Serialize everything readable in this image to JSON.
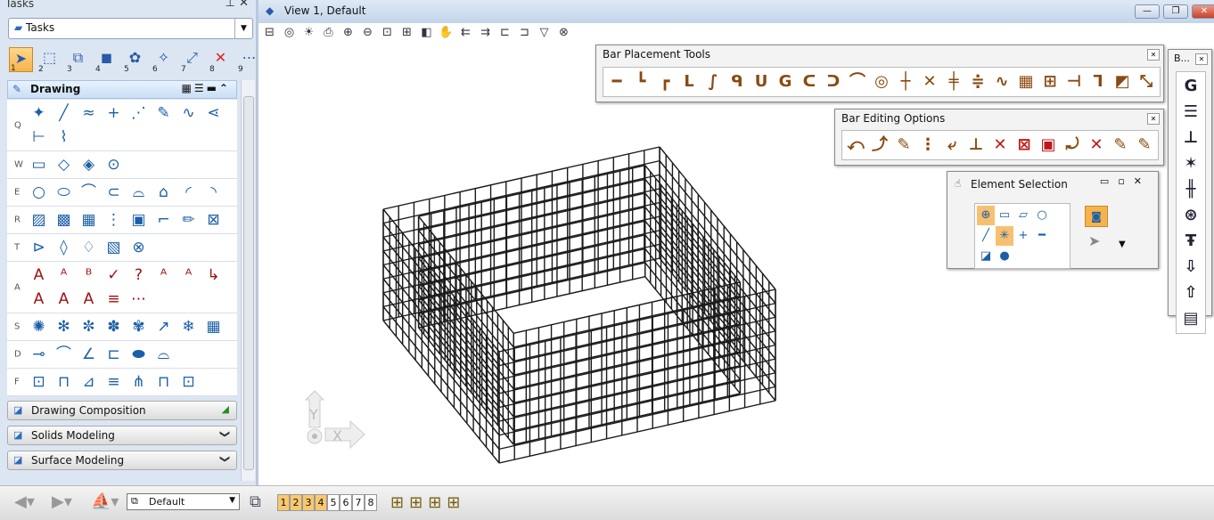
{
  "tasks_panel": {
    "title": "Tasks",
    "dropdown_value": "Tasks",
    "task_tools": [
      {
        "n": "1",
        "icon": "select-arrow-icon"
      },
      {
        "n": "2",
        "icon": "selection-box-icon"
      },
      {
        "n": "3",
        "icon": "3d-box-icon"
      },
      {
        "n": "4",
        "icon": "cube-icon"
      },
      {
        "n": "5",
        "icon": "render-icon"
      },
      {
        "n": "6",
        "icon": "light-icon"
      },
      {
        "n": "7",
        "icon": "scale-icon"
      },
      {
        "n": "8",
        "icon": "delete-icon"
      },
      {
        "n": "9",
        "icon": "measure-icon"
      }
    ],
    "drawing": {
      "label": "Drawing",
      "rows": [
        {
          "letter": "Q",
          "icons": [
            "place-smartline-icon",
            "line-icon",
            "multiline-icon",
            "point-icon",
            "polyline-icon",
            "pencil-line-icon",
            "curve-icon",
            "branch-icon",
            "dimension-icon",
            "construct-icon"
          ]
        },
        {
          "letter": "W",
          "icons": [
            "rectangle-icon",
            "shape-icon",
            "rotated-shape-icon",
            "circle-point-icon"
          ]
        },
        {
          "letter": "E",
          "icons": [
            "circle-icon",
            "ellipse-icon",
            "arc-icon",
            "arc-2-icon",
            "arc-3-icon",
            "arc-4-icon",
            "arc-5-icon",
            "arc-6-icon"
          ]
        },
        {
          "letter": "R",
          "icons": [
            "hatch-icon",
            "crosshatch-icon",
            "pattern-icon",
            "fill-icon",
            "region-icon",
            "area-icon",
            "edit-icon",
            "delete-pattern-icon"
          ]
        },
        {
          "letter": "T",
          "icons": [
            "cell-icon",
            "cell-2-icon",
            "cell-3-icon",
            "cell-4-icon",
            "cell-delete-icon"
          ]
        },
        {
          "letter": "A",
          "icons": [
            "text-icon",
            "text-leader-icon",
            "text-above-icon",
            "spell-check-icon",
            "text-query-icon",
            "text-scale-icon",
            "text-up-icon",
            "text-node-icon",
            "text-replace-icon",
            "text-align-icon",
            "text-align-2-icon",
            "text-box-icon",
            "text-note-icon"
          ]
        },
        {
          "letter": "S",
          "icons": [
            "snowflake-icon",
            "snowflake-2-icon",
            "snowflake-3-icon",
            "snowflake-4-icon",
            "snowflake-5-icon",
            "arrow-icon",
            "snowflake-6-icon",
            "table-icon"
          ]
        },
        {
          "letter": "D",
          "icons": [
            "dimension-linear-icon",
            "dimension-radial-icon",
            "dimension-angle-icon",
            "dimension-size-icon",
            "dimension-ordinate-icon",
            "dimension-element-icon"
          ]
        },
        {
          "letter": "F",
          "icons": [
            "frame-icon",
            "frame-2-icon",
            "frame-3-icon",
            "frame-4-icon",
            "frame-5-icon",
            "frame-6-icon",
            "frame-7-icon"
          ]
        }
      ]
    },
    "sections": [
      {
        "label": "Drawing Composition",
        "icon": "drawing-composition-icon"
      },
      {
        "label": "Solids Modeling",
        "icon": "solids-icon"
      },
      {
        "label": "Surface Modeling",
        "icon": "surface-icon"
      }
    ]
  },
  "view": {
    "title": "View 1, Default",
    "toolbar": [
      "view-attributes-icon",
      "display-style-icon",
      "lighting-icon",
      "print-icon",
      "zoom-in-icon",
      "zoom-out-icon",
      "fit-view-icon",
      "window-area-icon",
      "rotate-view-icon",
      "pan-icon",
      "view-previous-icon",
      "view-next-icon",
      "copy-view-icon",
      "clip-volume-icon",
      "filter-icon",
      "camera-icon"
    ]
  },
  "bar_placement": {
    "title": "Bar Placement Tools",
    "icons": [
      "straight-bar-icon",
      "l-bar-icon",
      "hook-bar-icon",
      "u-bar-icon",
      "crank-bar-icon",
      "stirrup-icon",
      "u-stirrup-icon",
      "spiral-bar-icon",
      "closed-stirrup-icon",
      "link-icon",
      "bend-icon",
      "circular-bar-icon",
      "cross-bar-icon",
      "diagonal-bar-icon",
      "lap-bar-icon",
      "bundle-icon",
      "wave-bar-icon",
      "mesh-icon",
      "coupler-icon",
      "end-anchor-icon",
      "corner-bar-icon",
      "edit-bar-icon",
      "extend-bar-icon"
    ]
  },
  "bar_editing": {
    "title": "Bar Editing Options",
    "icons": [
      "modify-shape-icon",
      "modify-hook-icon",
      "modify-bend-icon",
      "modify-spacing-icon",
      "copy-bar-icon",
      "move-bar-icon",
      "delete-set-icon",
      "delete-hatch-icon",
      "delete-region-icon",
      "undo-bar-icon",
      "delete-bar-icon",
      "edit-properties-icon",
      "edit-annotation-icon"
    ]
  },
  "element_selection": {
    "title": "Element Selection",
    "icons": [
      "individual-icon",
      "block-icon",
      "shape-icon",
      "circle-icon",
      "line-icon",
      "new-icon",
      "add-icon",
      "subtract-icon",
      "invert-icon",
      "select-all-icon"
    ]
  },
  "b_toolbar": {
    "title": "B...",
    "icons": [
      "grid-icon",
      "layers-icon",
      "bars-icon",
      "tools-icon",
      "rebar-icon",
      "hook-icon",
      "label-icon",
      "download-icon",
      "upload-icon",
      "report-icon"
    ]
  },
  "status_bar": {
    "view_group": "Default",
    "views": [
      "1",
      "2",
      "3",
      "4",
      "5",
      "6",
      "7",
      "8"
    ],
    "active_views": [
      "1",
      "2",
      "3",
      "4"
    ]
  },
  "colors": {
    "accent": "#f7b24a",
    "panel": "#dce6f2"
  }
}
